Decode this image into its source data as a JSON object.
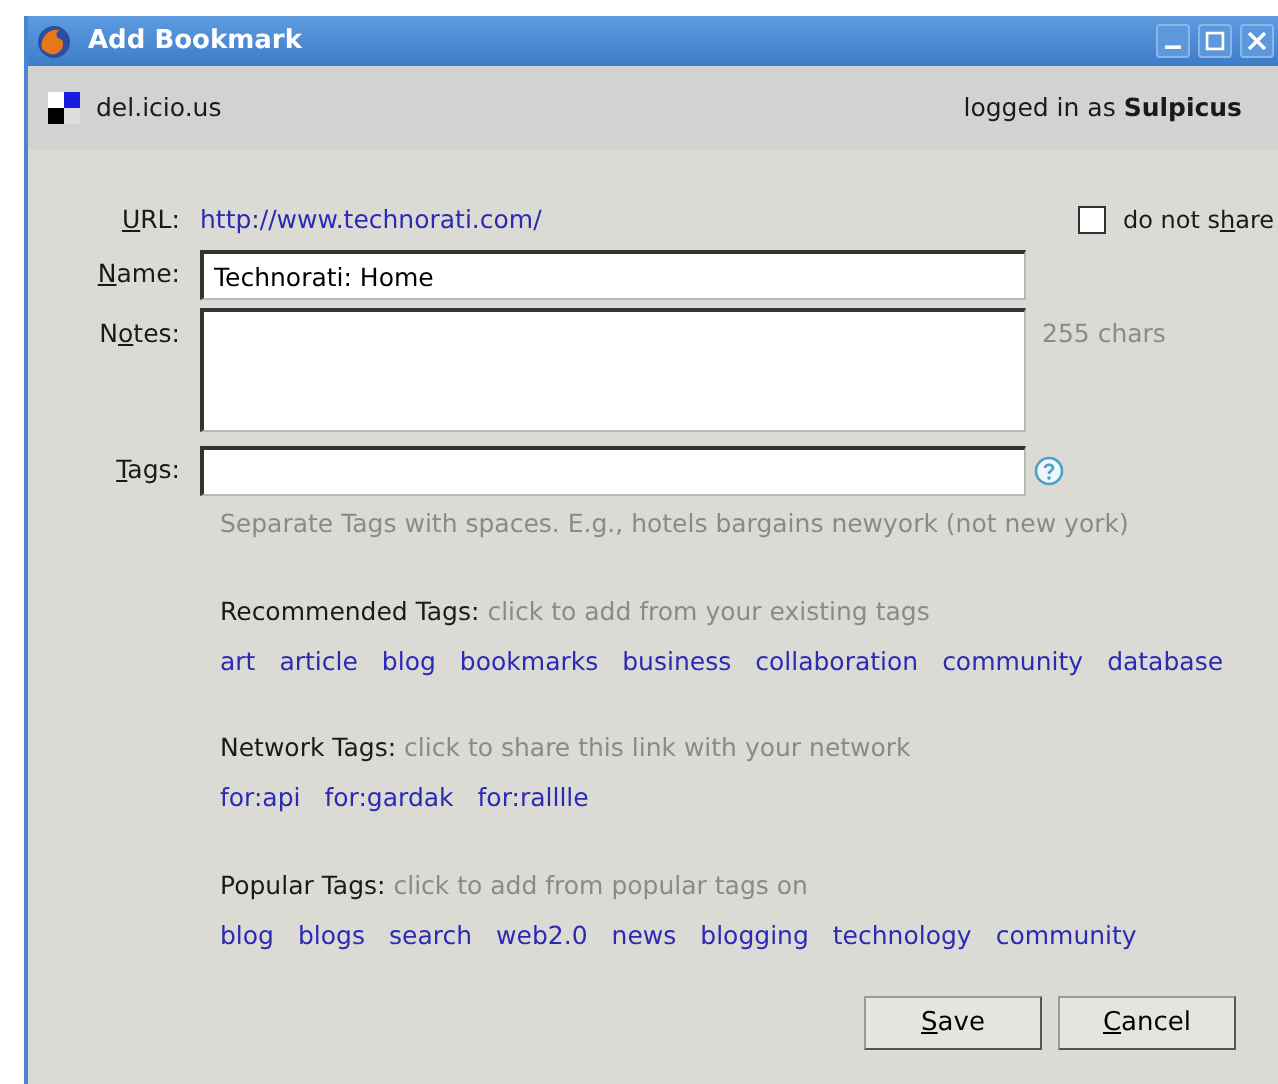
{
  "window": {
    "title": "Add Bookmark"
  },
  "header": {
    "site": "del.icio.us",
    "login_prefix": "logged in as",
    "user": "Sulpicus"
  },
  "url": {
    "label": {
      "key": "U",
      "after": "RL:"
    },
    "value": "http://www.technorati.com/"
  },
  "do_not_share": {
    "label": {
      "before": "do not s",
      "key": "h",
      "after": "are"
    },
    "checked": false
  },
  "name": {
    "label": {
      "key": "N",
      "after": "ame:"
    },
    "value": "Technorati: Home"
  },
  "notes": {
    "label": {
      "before": "N",
      "key": "o",
      "after": "tes:"
    },
    "counter": "255 chars"
  },
  "tags": {
    "label": {
      "key": "T",
      "after": "ags:"
    },
    "hint": "Separate Tags with spaces. E.g., hotels bargains newyork (not new york)"
  },
  "tag_groups": [
    {
      "title": "Recommended Tags:",
      "description": "click to add from your existing tags",
      "tags": [
        "art",
        "article",
        "blog",
        "bookmarks",
        "business",
        "collaboration",
        "community",
        "database"
      ]
    },
    {
      "title": "Network Tags:",
      "description": "click to share this link with your network",
      "tags": [
        "for:api",
        "for:gardak",
        "for:ralllle"
      ]
    },
    {
      "title": "Popular Tags:",
      "description": "click to add from popular tags on",
      "tags": [
        "blog",
        "blogs",
        "search",
        "web2.0",
        "news",
        "blogging",
        "technology",
        "community"
      ]
    }
  ],
  "buttons": [
    {
      "label": {
        "key": "S",
        "after": "ave"
      }
    },
    {
      "label": {
        "key": "C",
        "after": "ancel"
      }
    }
  ]
}
